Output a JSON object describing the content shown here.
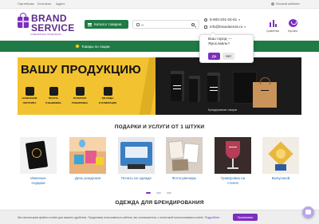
{
  "topbar": {
    "links": [
      "Партнёрам",
      "Контакты",
      "Адрес"
    ],
    "login": "Личный кабинет"
  },
  "logo": {
    "line1": "BRAND",
    "line2": "SERVICE",
    "tagline": "СУВЕНИРНАЯ ПРОДУКЦИЯ"
  },
  "header": {
    "catalog_label": "Каталог товаров",
    "search_placeholder": "Я",
    "phone": "8-800-201-04-81",
    "email": "info@brandservis.ru",
    "city": "Ярославль",
    "compare_label": "Сравнение",
    "cart_label": "Корзина"
  },
  "navbar": {
    "promo_label": "Товары по Акции"
  },
  "city_popup": {
    "question_line1": "Ваш город —",
    "question_line2": "Ярославль?",
    "yes": "Да",
    "no": "Нет"
  },
  "banner": {
    "headline": "ВАШУ ПРОДУКЦИЮ",
    "features": [
      {
        "line1": "НАНЕСЕНИЕ",
        "line2": "ЛОГОТИПА"
      },
      {
        "line1": "ПЕЧАТЬ",
        "line2": "И ВЫШИВКА"
      },
      {
        "line1": "ЛАЗЕРНАЯ",
        "line2": "ГРАВИРОВКА"
      },
      {
        "line1": "QR-КОДЫ",
        "line2": "И НУМЕРАЦИЯ"
      }
    ],
    "caption": "Брендирование товаров"
  },
  "gifts": {
    "title": "ПОДАРКИ И УСЛУГИ ОТ 1 ШТУКИ",
    "items": [
      {
        "label1": "Именные",
        "label2": "подарки"
      },
      {
        "label1": "День рождения",
        "label2": ""
      },
      {
        "label1": "Печать на одежде",
        "label2": ""
      },
      {
        "label1": "Фотосувениры",
        "label2": ""
      },
      {
        "label1": "Гравировка на",
        "label2": "стекле"
      },
      {
        "label1": "Выпускной",
        "label2": ""
      }
    ]
  },
  "clothing": {
    "title": "ОДЕЖДА ДЛЯ БРЕНДИРОВАНИЯ"
  },
  "cookie": {
    "text": "Мы используем файлы cookie для вашего удобства. Продолжая пользоваться сайтом, вы соглашаетесь с политикой использования cookie.",
    "more": "Подробнее",
    "accept": "Принимаю"
  },
  "colors": {
    "brand_purple": "#7b2fbe",
    "nav_green": "#1f7a45",
    "banner_yellow": "#f2c230"
  }
}
